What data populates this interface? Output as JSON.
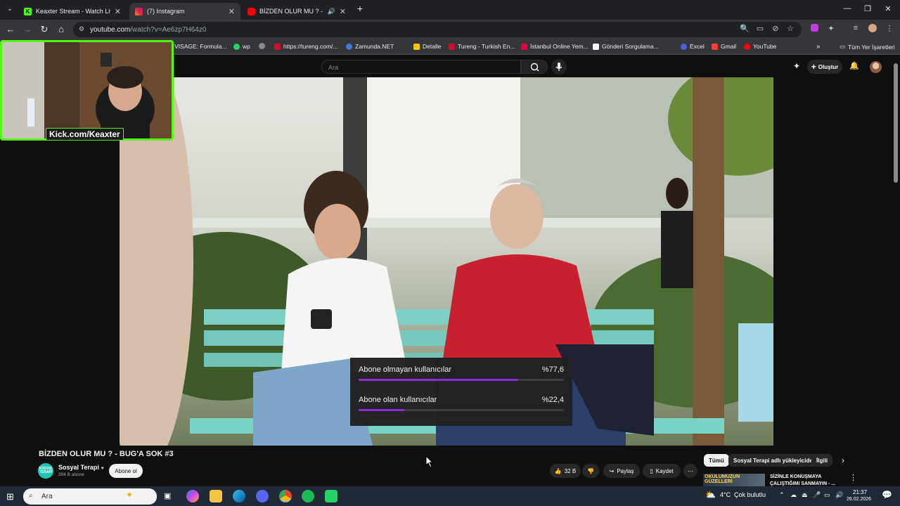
{
  "tabs": [
    {
      "title": "Kеахter Stream - Watch Live on",
      "favicon_color": "#53fc18",
      "active": false
    },
    {
      "title": "(7) Instagram",
      "favicon_color": "#d6249f",
      "active": true
    },
    {
      "title": "BİZDEN OLUR MU ? - BUG'A",
      "favicon_color": "#ff0000",
      "active": false
    }
  ],
  "browser": {
    "url_host": "youtube.com",
    "url_path": "/watch?v=Ae6zp7H64z0"
  },
  "bookmarks": [
    {
      "label": "VISAGE: Formula...",
      "color": "#555555"
    },
    {
      "label": "wp",
      "color": "#25d366"
    },
    {
      "label": "https://tureng.com/...",
      "color": "#c4122f"
    },
    {
      "label": "Zamunda.NET",
      "color": "#3a7bd5"
    },
    {
      "label": "Detalle",
      "color": "#f3c500"
    },
    {
      "label": "Tureng - Turkish En...",
      "color": "#c4122f"
    },
    {
      "label": "İstanbul Online Yem...",
      "color": "#e4003a"
    },
    {
      "label": "Gönderi Sorgulama...",
      "color": "#ffffff"
    },
    {
      "label": "Excel",
      "color": "#4a5fd9"
    },
    {
      "label": "Gmail",
      "color": "#ea4335"
    },
    {
      "label": "YouTube",
      "color": "#ff0000"
    }
  ],
  "all_bookmarks": "Tüm Yer İşaretleri",
  "yt": {
    "search_placeholder": "Ara",
    "create_label": "Oluştur"
  },
  "webcam": {
    "label": "Kick.com/Keaxter"
  },
  "poll": {
    "rows": [
      {
        "label": "Abone olmayan kullanıcılar",
        "percent_text": "%77,6",
        "fraction": 0.776
      },
      {
        "label": "Abone olan kullanıcılar",
        "percent_text": "%22,4",
        "fraction": 0.224
      }
    ]
  },
  "video": {
    "title": "BİZDEN OLUR MU ? - BUG'A SOK #3",
    "channel": "Sosyal Terapi",
    "channel_icon_text": "SOSYAL TERAPI",
    "subscribers": "394 B abone",
    "subscribe_label": "Abone ol",
    "likes": "32 B",
    "share_label": "Paylaş",
    "save_label": "Kaydet"
  },
  "chips": [
    "Tümü",
    "Sosyal Terapi adlı yükleyiciden",
    "İlgili"
  ],
  "related": {
    "thumb_text": "OKULUMUZUN GÜZELLERİ",
    "title": "SİZİNLE KONUŞMAYA ÇALIŞTIĞIMI SANMAYIN - ..."
  },
  "taskbar": {
    "search_label": "Ara",
    "weather": "4°C",
    "weather_desc": "Çok bulutlu",
    "time": "21:37",
    "date": "26.02.2026"
  }
}
